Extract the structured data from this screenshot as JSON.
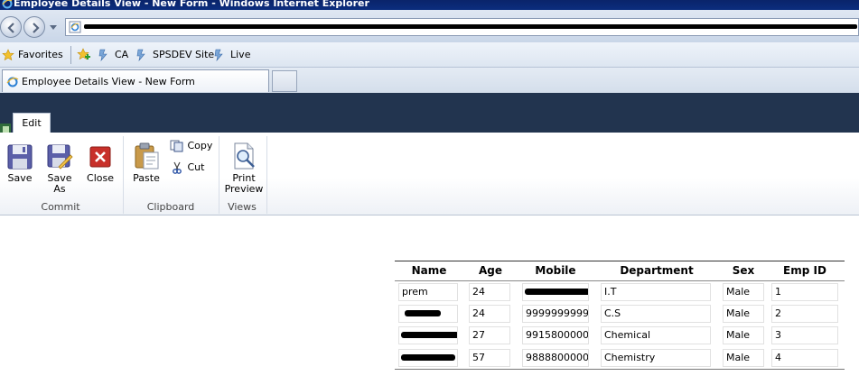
{
  "window": {
    "title": "Employee Details View - New Form - Windows Internet Explorer"
  },
  "favorites_bar": {
    "favorites_label": "Favorites",
    "links": [
      "CA",
      "SPSDEV Site",
      "Live"
    ]
  },
  "tab": {
    "title": "Employee Details View - New Form"
  },
  "ribbon": {
    "active_tab": "Edit",
    "groups": {
      "commit": {
        "label": "Commit",
        "save": "Save",
        "save_as_line1": "Save",
        "save_as_line2": "As",
        "close": "Close"
      },
      "clipboard": {
        "label": "Clipboard",
        "paste": "Paste",
        "copy": "Copy",
        "cut": "Cut"
      },
      "views": {
        "label": "Views",
        "print_preview_line1": "Print",
        "print_preview_line2": "Preview"
      }
    }
  },
  "table": {
    "headers": [
      "Name",
      "Age",
      "Mobile",
      "Department",
      "Sex",
      "Emp ID"
    ],
    "rows": [
      {
        "name": "prem",
        "age": "24",
        "mobile": "",
        "department": "I.T",
        "sex": "Male",
        "emp_id": "1"
      },
      {
        "name": "",
        "age": "24",
        "mobile": "9999999999",
        "department": "C.S",
        "sex": "Male",
        "emp_id": "2"
      },
      {
        "name": "",
        "age": "27",
        "mobile": "9915800000",
        "department": "Chemical",
        "sex": "Male",
        "emp_id": "3"
      },
      {
        "name": "",
        "age": "57",
        "mobile": "9888800000",
        "department": "Chemistry",
        "sex": "Male",
        "emp_id": "4"
      }
    ]
  },
  "colors": {
    "titlebar": "#0a246a",
    "ribbon_header": "#22344f",
    "close_red": "#c8302a"
  }
}
